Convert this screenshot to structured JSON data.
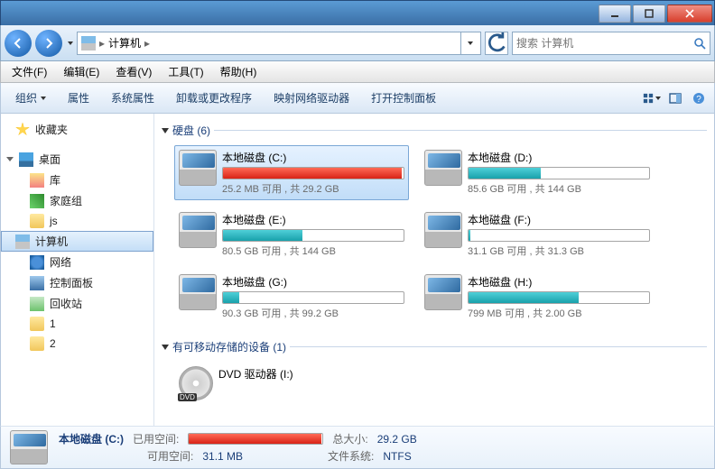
{
  "nav": {
    "breadcrumb_root_icon": "computer",
    "breadcrumb_label": "计算机",
    "search_placeholder": "搜索 计算机"
  },
  "menus": [
    "文件(F)",
    "编辑(E)",
    "查看(V)",
    "工具(T)",
    "帮助(H)"
  ],
  "commands": {
    "organize": "组织",
    "properties": "属性",
    "system_props": "系统属性",
    "uninstall": "卸载或更改程序",
    "map_drive": "映射网络驱动器",
    "control_panel": "打开控制面板"
  },
  "sidebar": {
    "favorites": "收藏夹",
    "desktop": "桌面",
    "libraries": "库",
    "homegroup": "家庭组",
    "js": "js",
    "computer": "计算机",
    "network": "网络",
    "cp": "控制面板",
    "recycle": "回收站",
    "one": "1",
    "two": "2"
  },
  "groups": {
    "disks": "硬盘 (6)",
    "removable": "有可移动存储的设备 (1)"
  },
  "drives": [
    {
      "name": "本地磁盘 (C:)",
      "free": "25.2 MB 可用 , 共 29.2 GB",
      "fill_pct": 99,
      "color": "red",
      "selected": true
    },
    {
      "name": "本地磁盘 (D:)",
      "free": "85.6 GB 可用 , 共 144 GB",
      "fill_pct": 40,
      "color": "teal",
      "selected": false
    },
    {
      "name": "本地磁盘 (E:)",
      "free": "80.5 GB 可用 , 共 144 GB",
      "fill_pct": 44,
      "color": "teal",
      "selected": false
    },
    {
      "name": "本地磁盘 (F:)",
      "free": "31.1 GB 可用 , 共 31.3 GB",
      "fill_pct": 1,
      "color": "teal",
      "selected": false
    },
    {
      "name": "本地磁盘 (G:)",
      "free": "90.3 GB 可用 , 共 99.2 GB",
      "fill_pct": 9,
      "color": "teal",
      "selected": false
    },
    {
      "name": "本地磁盘 (H:)",
      "free": "799 MB 可用 , 共 2.00 GB",
      "fill_pct": 61,
      "color": "teal",
      "selected": false
    }
  ],
  "dvd": {
    "name": "DVD 驱动器 (I:)",
    "badge": "DVD"
  },
  "status": {
    "title": "本地磁盘 (C:)",
    "used_label": "已用空间:",
    "avail_label": "可用空间:",
    "avail_value": "31.1 MB",
    "total_label": "总大小:",
    "total_value": "29.2 GB",
    "fs_label": "文件系统:",
    "fs_value": "NTFS",
    "bar_pct": 99,
    "bar_color": "red"
  }
}
